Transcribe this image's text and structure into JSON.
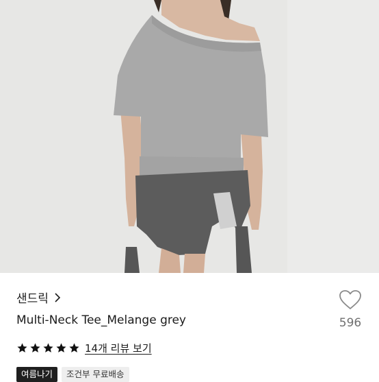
{
  "product": {
    "image_alt": "Model wearing grey melange off-shoulder tee with dark grey wrap skirt",
    "brand": "샌드릭",
    "title": "Multi-Neck Tee_Melange grey",
    "like_count": "596",
    "rating": {
      "stars": 5,
      "review_link": "14개 리뷰 보기"
    },
    "tags": [
      "여름나기",
      "조건부 무료배송"
    ]
  },
  "icons": {
    "brand_chevron": "chevron-right-icon",
    "like": "heart-outline-icon",
    "star": "star-filled-icon"
  },
  "colors": {
    "text": "#1b1b1b",
    "muted": "#707070",
    "tag_dark_bg": "#1f1f1f",
    "tag_light_bg": "#eeeeee"
  }
}
